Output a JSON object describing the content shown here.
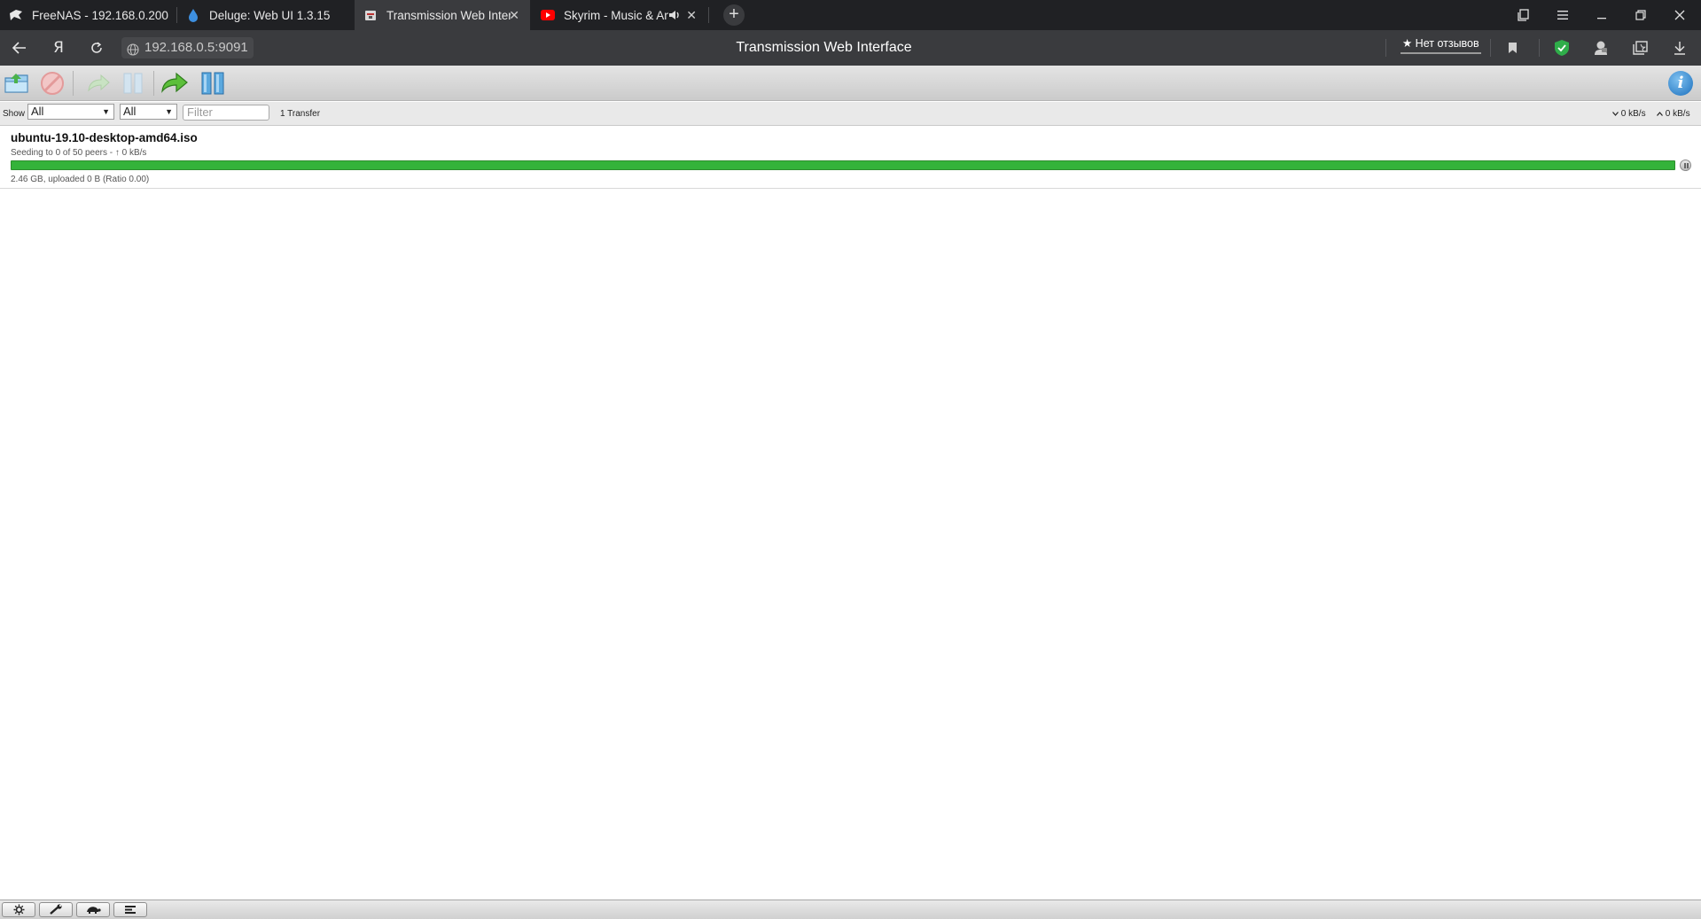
{
  "browser": {
    "tabs": [
      {
        "title": "FreeNAS - 192.168.0.200",
        "icon": "freenas-icon"
      },
      {
        "title": "Deluge: Web UI 1.3.15",
        "icon": "deluge-icon"
      },
      {
        "title": "Transmission Web Interf",
        "icon": "transmission-icon",
        "active": true
      },
      {
        "title": "Skyrim - Music & An",
        "icon": "youtube-icon",
        "audio": true
      }
    ],
    "close_glyph": "✕",
    "new_tab_glyph": "+",
    "address": "192.168.0.5:9091",
    "page_title": "Transmission Web Interface",
    "reviews_label": "★ Нет отзывов",
    "yandex_glyph": "Я"
  },
  "toolbar": {
    "buttons": [
      "open-torrent",
      "remove-torrent",
      "resume-selected",
      "pause-selected",
      "resume-all",
      "pause-all",
      "inspector-info"
    ]
  },
  "filterbar": {
    "show_label": "Show",
    "state_filter": "All",
    "tracker_filter": "All",
    "filter_placeholder": "Filter",
    "transfer_count": "1 Transfer",
    "download_speed": "0 kB/s",
    "upload_speed": "0 kB/s"
  },
  "torrents": [
    {
      "name": "ubuntu-19.10-desktop-amd64.iso",
      "peers": "Seeding to 0 of 50 peers - ↑ 0 kB/s",
      "progress_percent": 100,
      "details": "2.46 GB, uploaded 0 B (Ratio 0.00)"
    }
  ],
  "colors": {
    "progress_fill": "#34b33a",
    "browser_chrome": "#202124"
  }
}
